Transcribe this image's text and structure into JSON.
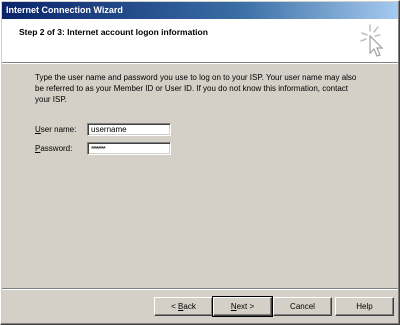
{
  "window": {
    "title": "Internet Connection Wizard"
  },
  "header": {
    "title": "Step 2 of 3: Internet account logon information",
    "icon": "wizard-wand-icon"
  },
  "main": {
    "intro": "Type the user name and password you use to log on to your ISP. Your user name may also be referred to as your Member ID or User ID. If you do not know this information, contact your ISP.",
    "username": {
      "label_mnemonic": "U",
      "label_rest": "ser name:",
      "value": "username"
    },
    "password": {
      "label_mnemonic": "P",
      "label_rest": "assword:",
      "masked_value": "********"
    }
  },
  "buttons": {
    "back_prefix": "< ",
    "back_mnemonic": "B",
    "back_rest": "ack",
    "next_mnemonic": "N",
    "next_rest": "ext >",
    "cancel": "Cancel",
    "help": "Help"
  }
}
